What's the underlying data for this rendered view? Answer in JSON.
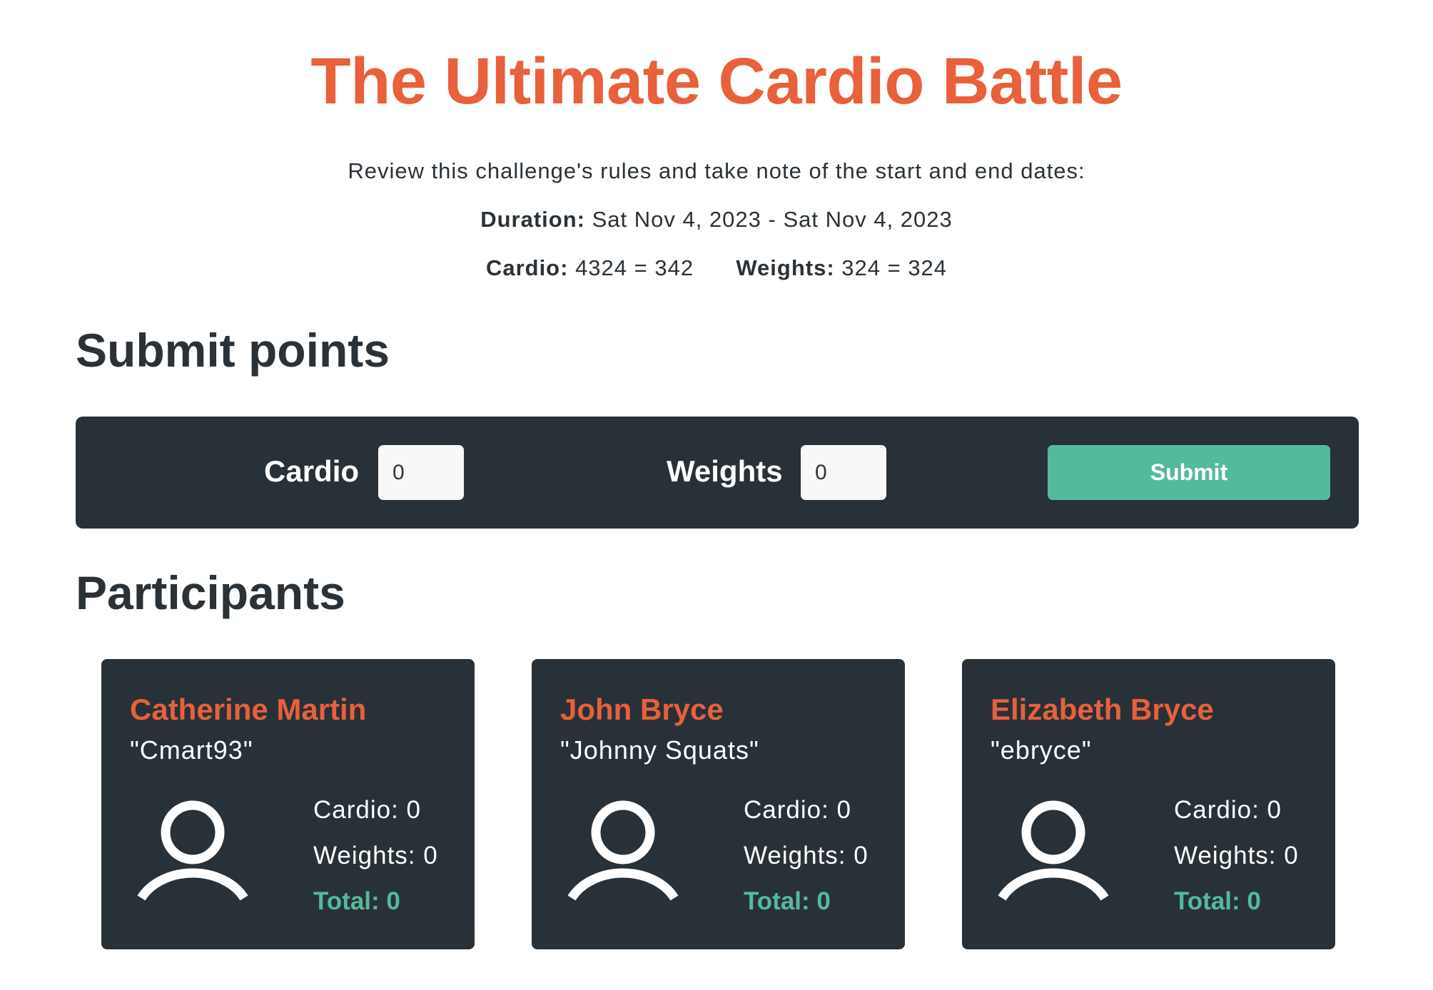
{
  "header": {
    "title": "The Ultimate Cardio Battle",
    "intro": "Review this challenge's rules and take note of the start and end dates:",
    "duration_label": "Duration:",
    "duration_value": "Sat Nov 4, 2023 - Sat Nov 4, 2023",
    "cardio_label": "Cardio:",
    "cardio_value": "4324 = 342",
    "weights_label": "Weights:",
    "weights_value": "324 = 324"
  },
  "submit_section": {
    "heading": "Submit points",
    "cardio_label": "Cardio",
    "cardio_value": "0",
    "weights_label": "Weights",
    "weights_value": "0",
    "submit_label": "Submit"
  },
  "participants_section": {
    "heading": "Participants",
    "participants": [
      {
        "name": "Catherine Martin",
        "nickname": "\"Cmart93\"",
        "cardio": "Cardio: 0",
        "weights": "Weights: 0",
        "total": "Total: 0"
      },
      {
        "name": "John Bryce",
        "nickname": "\"Johnny Squats\"",
        "cardio": "Cardio: 0",
        "weights": "Weights: 0",
        "total": "Total: 0"
      },
      {
        "name": "Elizabeth Bryce",
        "nickname": "\"ebryce\"",
        "cardio": "Cardio: 0",
        "weights": "Weights: 0",
        "total": "Total: 0"
      }
    ],
    "avatar_icon": "user-icon"
  },
  "colors": {
    "accent": "#e8603c",
    "success": "#54ba9c",
    "panel": "#283137",
    "text": "#2a3238"
  }
}
